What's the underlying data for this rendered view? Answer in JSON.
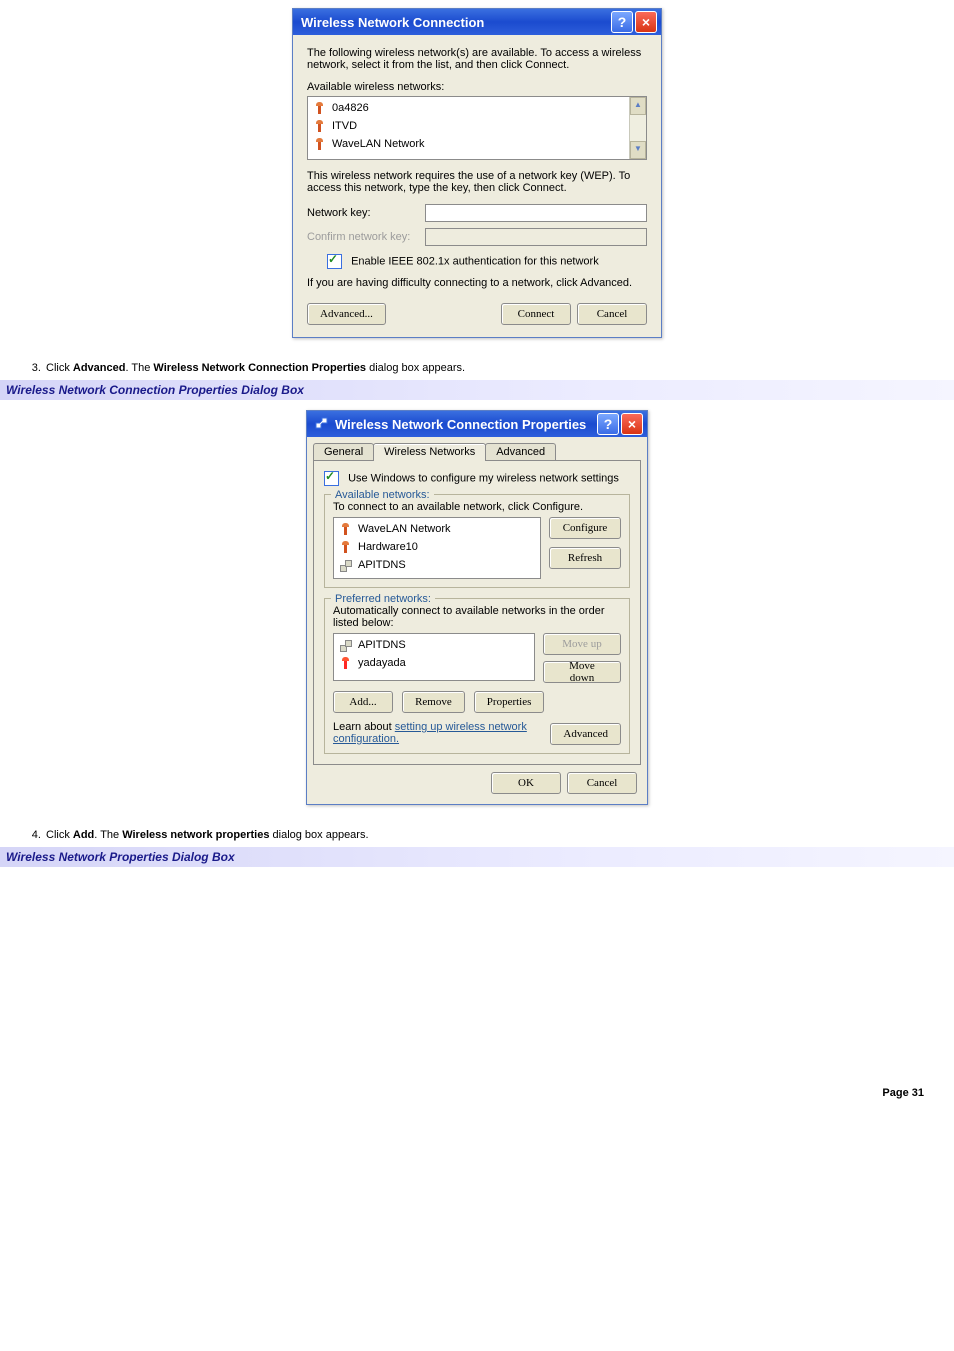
{
  "dialog1": {
    "title": "Wireless Network Connection",
    "intro": "The following wireless network(s) are available. To access a wireless network, select it from the list, and then click Connect.",
    "available_label": "Available wireless networks:",
    "networks": [
      {
        "name": "0a4826"
      },
      {
        "name": "ITVD"
      },
      {
        "name": "WaveLAN Network"
      }
    ],
    "wep_text": "This wireless network requires the use of a network key (WEP). To access this network, type the key, then click Connect.",
    "network_key_label": "Network key:",
    "confirm_key_label": "Confirm network key:",
    "ieee_checkbox_label": "Enable IEEE 802.1x authentication for this network",
    "difficulty_text": "If you are having difficulty connecting to a network, click Advanced.",
    "advanced_btn": "Advanced...",
    "connect_btn": "Connect",
    "cancel_btn": "Cancel"
  },
  "step3": {
    "prefix": "Click ",
    "bold1": "Advanced",
    "mid": ". The ",
    "bold2": "Wireless Network Connection Properties",
    "suffix": " dialog box appears."
  },
  "caption1": "Wireless Network Connection Properties Dialog Box",
  "dialog2": {
    "title": "Wireless Network Connection Properties",
    "tabs": [
      "General",
      "Wireless Networks",
      "Advanced"
    ],
    "active_tab_index": 1,
    "use_windows_label": "Use Windows to configure my wireless network settings",
    "available_group": "Available networks:",
    "available_text": "To connect to an available network, click Configure.",
    "available_networks": [
      {
        "name": "WaveLAN Network",
        "icon": "antenna"
      },
      {
        "name": "Hardware10",
        "icon": "antenna"
      },
      {
        "name": "APITDNS",
        "icon": "adhoc"
      }
    ],
    "configure_btn": "Configure",
    "refresh_btn": "Refresh",
    "preferred_group": "Preferred networks:",
    "preferred_text": "Automatically connect to available networks in the order listed below:",
    "preferred_networks": [
      {
        "name": "APITDNS",
        "icon": "adhoc"
      },
      {
        "name": "yadayada",
        "icon": "antenna-red"
      }
    ],
    "moveup_btn": "Move up",
    "movedown_btn": "Move down",
    "add_btn": "Add...",
    "remove_btn": "Remove",
    "properties_btn": "Properties",
    "learn_prefix": "Learn about ",
    "learn_link": "setting up wireless network configuration.",
    "advanced_btn": "Advanced",
    "ok_btn": "OK",
    "cancel_btn": "Cancel"
  },
  "step4": {
    "prefix": "Click ",
    "bold1": "Add",
    "mid": ". The ",
    "bold2": "Wireless network properties",
    "suffix": " dialog box appears."
  },
  "caption2": "Wireless Network Properties Dialog Box",
  "page_number": "Page 31"
}
